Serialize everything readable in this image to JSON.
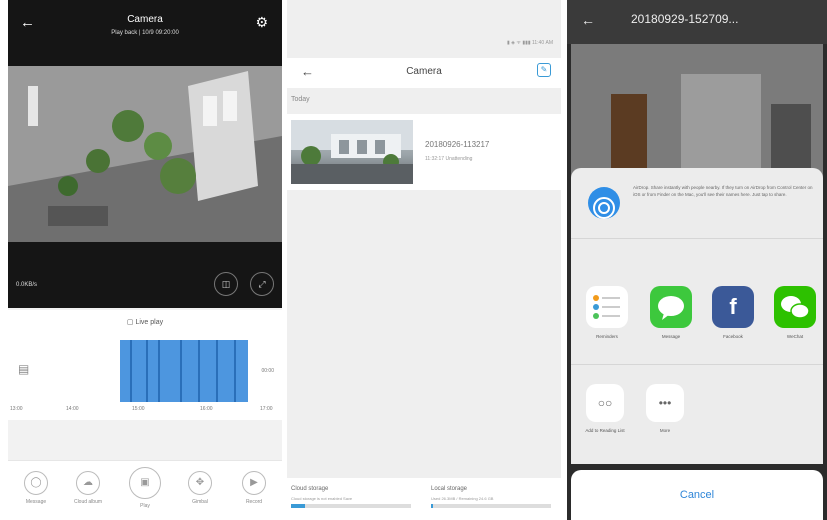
{
  "live": {
    "title": "Camera",
    "subtitle": "Play back | 10/9 09:20:00",
    "speed": "0.0KB/s",
    "back_to_live": "Live play",
    "timeline_side_label": "00:00",
    "ticks": [
      "13:00",
      "14:00",
      "15:00",
      "16:00",
      "17:00"
    ],
    "tools": [
      {
        "label": "Message",
        "icon": "chat-bubble-icon"
      },
      {
        "label": "Cloud album",
        "icon": "cloud-icon"
      },
      {
        "label": "Play",
        "icon": "save-icon"
      },
      {
        "label": "Gimbal",
        "icon": "direction-icon"
      },
      {
        "label": "Record",
        "icon": "video-camera-icon"
      }
    ]
  },
  "album": {
    "status_bar": "▮ ◈ ᯤ ▮▮▮ 11:40 AM",
    "title": "Camera",
    "section": "Today",
    "item_name": "20180926-113217",
    "item_meta": "11:32:17 Unattending",
    "cloud_storage": {
      "title": "Cloud storage",
      "desc": "Cloud storage is not enabled Save",
      "fill": 0.12
    },
    "local_storage": {
      "title": "Local storage",
      "desc": "Used 26.3MB / Remaining 24.6 GB",
      "fill": 0.02
    }
  },
  "share": {
    "title": "20180929-152709...",
    "airdrop_text": "AirDrop. Share instantly with people nearby. If they turn on AirDrop from Control Center on iOS or from Finder on the Mac, you'll see their names here. Just tap to share.",
    "apps": [
      {
        "label": "Reminders",
        "glyph": "",
        "color": "#ffffff"
      },
      {
        "label": "Message",
        "glyph": "💬",
        "color": "#3dc83d"
      },
      {
        "label": "Facebook",
        "glyph": "f",
        "color": "#3b5998"
      },
      {
        "label": "WeChat",
        "glyph": "💬",
        "color": "#2dc100"
      }
    ],
    "actions": [
      {
        "label": "Add to Reading List",
        "glyph": "○○"
      },
      {
        "label": "More",
        "glyph": "•••"
      }
    ],
    "cancel": "Cancel"
  }
}
